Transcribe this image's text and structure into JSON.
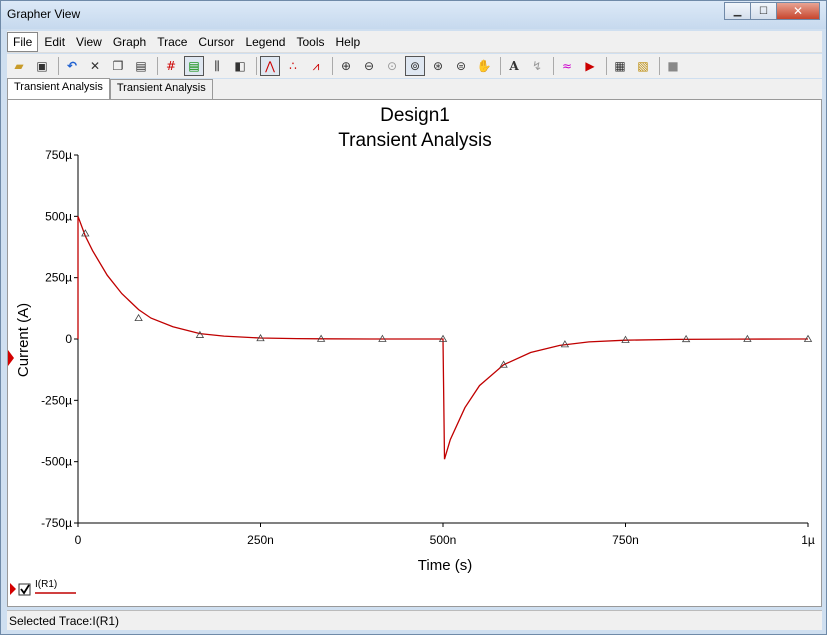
{
  "window": {
    "title": "Grapher View",
    "minimize_icon": "minimize-icon",
    "maximize_icon": "maximize-icon",
    "close_icon": "close-icon"
  },
  "menu": [
    "File",
    "Edit",
    "View",
    "Graph",
    "Trace",
    "Cursor",
    "Legend",
    "Tools",
    "Help"
  ],
  "tabs": [
    "Transient Analysis",
    "Transient Analysis"
  ],
  "status": "Selected Trace:I(R1)",
  "legend": {
    "label": "I(R1)",
    "checked": true
  },
  "colors": {
    "trace": "#c00000",
    "marker": "#e00000"
  },
  "chart_data": {
    "type": "line",
    "title": "Design1",
    "subtitle": "Transient Analysis",
    "xlabel": "Time (s)",
    "ylabel": "Current (A)",
    "xlim": [
      0,
      1e-06
    ],
    "ylim": [
      -0.00075,
      0.00075
    ],
    "xticks": [
      0,
      2.5e-07,
      5e-07,
      7.5e-07,
      1e-06
    ],
    "xtick_labels": [
      "0",
      "250n",
      "500n",
      "750n",
      "1µ"
    ],
    "yticks": [
      0.00075,
      0.0005,
      0.00025,
      0,
      -0.00025,
      -0.0005,
      -0.00075
    ],
    "ytick_labels": [
      "750µ",
      "500µ",
      "250µ",
      "0",
      "-250µ",
      "-500µ",
      "-750µ"
    ],
    "grid": false,
    "series": [
      {
        "name": "I(R1)",
        "x": [
          0,
          1e-08,
          2e-08,
          4e-08,
          6e-08,
          8.3e-08,
          1e-07,
          1.3e-07,
          1.67e-07,
          2e-07,
          2.5e-07,
          3e-07,
          3.33e-07,
          4e-07,
          4.17e-07,
          4.5e-07,
          5e-07,
          5.02e-07,
          5.1e-07,
          5.3e-07,
          5.5e-07,
          5.83e-07,
          6.2e-07,
          6.6e-07,
          7e-07,
          7.5e-07,
          8.2e-07,
          9e-07,
          9.8e-07,
          1e-06
        ],
        "y": [
          0.0005,
          0.00042,
          0.00036,
          0.00026,
          0.000185,
          0.00012,
          8.5e-05,
          5e-05,
          2.2e-05,
          1.2e-05,
          4e-06,
          1.5e-06,
          8e-07,
          2e-07,
          1e-07,
          0,
          0,
          -0.00049,
          -0.00041,
          -0.00028,
          -0.00019,
          -0.000105,
          -5.5e-05,
          -2.6e-05,
          -1.2e-05,
          -5e-06,
          -1.5e-06,
          -3e-07,
          0,
          0
        ]
      }
    ],
    "markers": {
      "x": [
        1e-08,
        8.3e-08,
        1.67e-07,
        2.5e-07,
        3.33e-07,
        4.17e-07,
        5e-07,
        5.83e-07,
        6.67e-07,
        7.5e-07,
        8.33e-07,
        9.17e-07,
        1e-06
      ],
      "y": [
        0.00043,
        8.5e-05,
        1.6e-05,
        3e-06,
        5e-07,
        1e-07,
        0,
        -0.000105,
        -2.2e-05,
        -4e-06,
        -8e-07,
        -1e-07,
        0
      ]
    }
  }
}
